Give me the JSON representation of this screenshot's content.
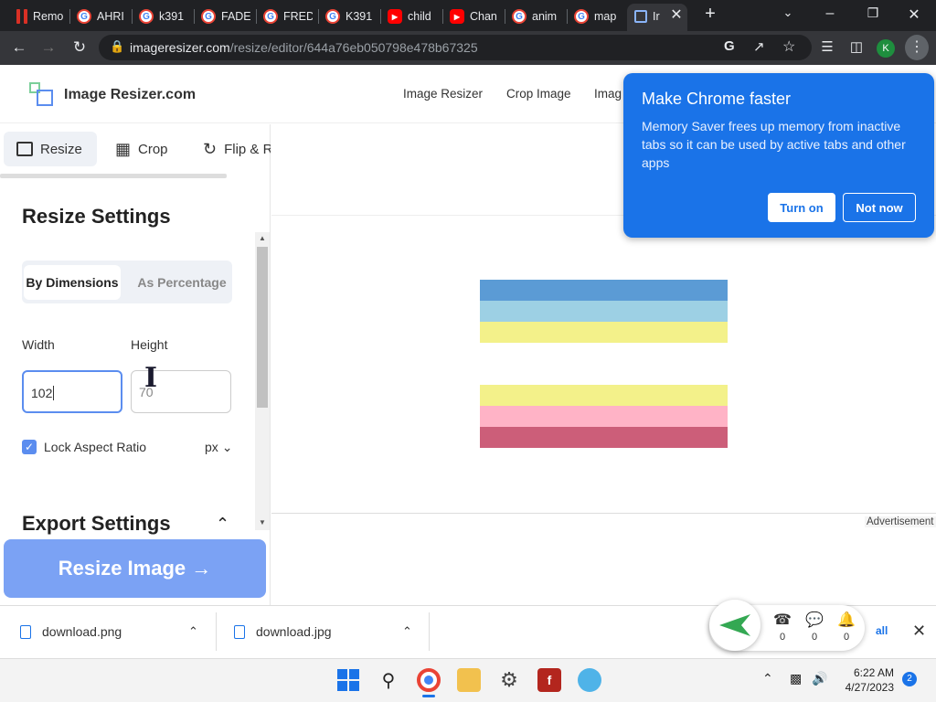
{
  "browser": {
    "tabs": [
      {
        "label": "Remo",
        "favicon": "red-bars"
      },
      {
        "label": "AHRI",
        "favicon": "google"
      },
      {
        "label": "k391",
        "favicon": "google"
      },
      {
        "label": "FADE",
        "favicon": "google"
      },
      {
        "label": "FRED",
        "favicon": "google"
      },
      {
        "label": "K391",
        "favicon": "google"
      },
      {
        "label": "child",
        "favicon": "youtube"
      },
      {
        "label": "Chan",
        "favicon": "youtube"
      },
      {
        "label": "anim",
        "favicon": "google"
      },
      {
        "label": "map",
        "favicon": "google"
      },
      {
        "label": "Ir",
        "favicon": "image-resizer"
      }
    ],
    "new_tab": "+",
    "url_domain": "imageresizer.com",
    "url_path": "/resize/editor/644a76eb050798e478b67325",
    "profile_initial": "K"
  },
  "site": {
    "logo_text": "Image Resizer.com",
    "nav": [
      "Image Resizer",
      "Crop Image",
      "Imag"
    ]
  },
  "tools": {
    "resize": "Resize",
    "crop": "Crop",
    "flip": "Flip & R"
  },
  "settings": {
    "title": "Resize Settings",
    "mode_dimensions": "By Dimensions",
    "mode_percentage": "As Percentage",
    "width_label": "Width",
    "height_label": "Height",
    "width_value": "102",
    "height_value": "70",
    "lock_label": "Lock Aspect Ratio",
    "lock_checked": true,
    "unit": "px",
    "export_title": "Export Settings",
    "resize_button": "Resize Image →"
  },
  "canvas": {
    "stripe_colors": [
      "#5b9bd5",
      "#9dd0e4",
      "#f3f18a",
      "#ffffff",
      "#ffffff",
      "#f3f18a",
      "#ffb3c6",
      "#cc5e79"
    ]
  },
  "ad_label": "Advertisement",
  "popup": {
    "title": "Make Chrome faster",
    "body": "Memory Saver frees up memory from inactive tabs so it can be used by active tabs and other apps",
    "turn_on": "Turn on",
    "not_now": "Not now"
  },
  "downloads": {
    "items": [
      "download.png",
      "download.jpg"
    ],
    "show_all": "all"
  },
  "widget": {
    "counts": [
      "0",
      "0",
      "0"
    ]
  },
  "taskbar": {
    "time": "6:22 AM",
    "date": "4/27/2023",
    "notifications": "2"
  }
}
